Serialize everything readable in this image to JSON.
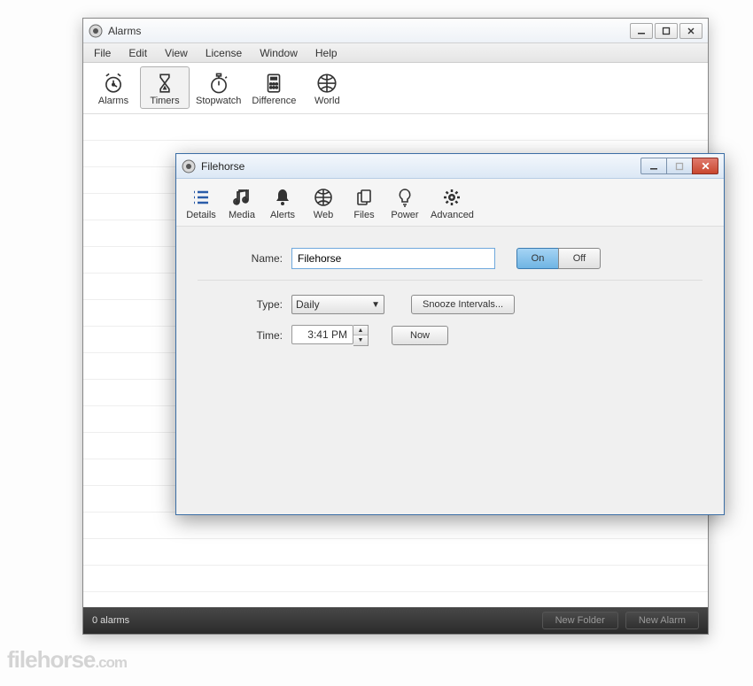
{
  "main_window": {
    "title": "Alarms",
    "menubar": [
      "File",
      "Edit",
      "View",
      "License",
      "Window",
      "Help"
    ],
    "toolbar": [
      {
        "key": "alarms",
        "label": "Alarms"
      },
      {
        "key": "timers",
        "label": "Timers"
      },
      {
        "key": "stopwatch",
        "label": "Stopwatch"
      },
      {
        "key": "difference",
        "label": "Difference"
      },
      {
        "key": "world",
        "label": "World"
      }
    ],
    "statusbar": {
      "count_text": "0 alarms",
      "new_folder_label": "New Folder",
      "new_alarm_label": "New Alarm"
    }
  },
  "dialog": {
    "title": "Filehorse",
    "toolbar": [
      {
        "key": "details",
        "label": "Details"
      },
      {
        "key": "media",
        "label": "Media"
      },
      {
        "key": "alerts",
        "label": "Alerts"
      },
      {
        "key": "web",
        "label": "Web"
      },
      {
        "key": "files",
        "label": "Files"
      },
      {
        "key": "power",
        "label": "Power"
      },
      {
        "key": "advanced",
        "label": "Advanced"
      }
    ],
    "form": {
      "name_label": "Name:",
      "name_value": "Filehorse",
      "on_label": "On",
      "off_label": "Off",
      "type_label": "Type:",
      "type_value": "Daily",
      "snooze_label": "Snooze Intervals...",
      "time_label": "Time:",
      "time_value": "3:41 PM",
      "now_label": "Now"
    }
  },
  "watermark": {
    "brand": "filehorse",
    "suffix": ".com"
  }
}
